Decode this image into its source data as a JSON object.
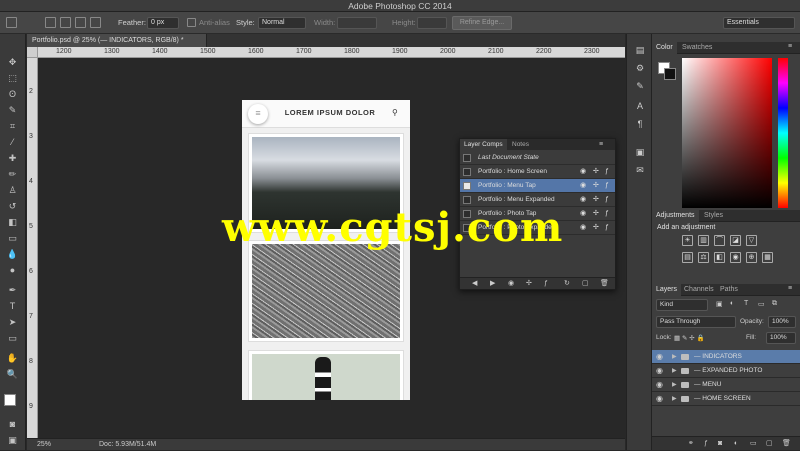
{
  "window": {
    "title": "Adobe Photoshop CC 2014"
  },
  "options_bar": {
    "feather_label": "Feather:",
    "feather_value": "0 px",
    "anti_alias_label": "Anti-alias",
    "style_label": "Style:",
    "style_value": "Normal",
    "width_label": "Width:",
    "height_label": "Height:",
    "refine_edge_label": "Refine Edge...",
    "workspace_value": "Essentials"
  },
  "document": {
    "tab_label": "Portfolio.psd @ 25% (— INDICATORS, RGB/8) *",
    "ruler_h": [
      "1200",
      "1300",
      "1400",
      "1500",
      "1600",
      "1700",
      "1800",
      "1900",
      "2000",
      "2100",
      "2200",
      "2300"
    ],
    "ruler_v": [
      "2",
      "3",
      "4",
      "5",
      "6",
      "7",
      "8",
      "9"
    ]
  },
  "mock_app": {
    "title": "LOREM IPSUM DOLOR"
  },
  "layer_comps": {
    "tabs": [
      "Layer Comps",
      "Notes"
    ],
    "rows": [
      {
        "label": "Last Document State"
      },
      {
        "label": "Portfolio : Home Screen"
      },
      {
        "label": "Portfolio : Menu Tap"
      },
      {
        "label": "Portfolio : Menu Expanded"
      },
      {
        "label": "Portfolio : Photo Tap"
      },
      {
        "label": "Portfolio : Photo Expanded"
      }
    ]
  },
  "panels": {
    "color_tabs": [
      "Color",
      "Swatches"
    ],
    "adjust_tabs": [
      "Adjustments",
      "Styles"
    ],
    "adjust_hint": "Add an adjustment",
    "layers_tabs": [
      "Layers",
      "Channels",
      "Paths"
    ],
    "kind_value": "Kind",
    "blend_value": "Pass Through",
    "opacity_label": "Opacity:",
    "opacity_value": "100%",
    "lock_label": "Lock:",
    "fill_label": "Fill:",
    "fill_value": "100%",
    "layers": [
      {
        "name": "— INDICATORS"
      },
      {
        "name": "— EXPANDED PHOTO"
      },
      {
        "name": "— MENU"
      },
      {
        "name": "— HOME SCREEN"
      }
    ]
  },
  "status": {
    "zoom": "25%",
    "doc": "Doc: 5.93M/51.4M"
  },
  "watermark": "www.cgtsj.com",
  "colors": {
    "accent_selected": "#5476a8",
    "watermark": "#ffff00",
    "ui_dark": "#3e3e3e"
  }
}
